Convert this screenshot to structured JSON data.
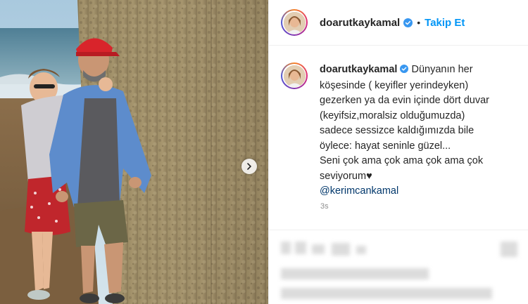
{
  "post": {
    "username": "doarutkaykamal",
    "follow_label": "Takip Et",
    "separator": "•",
    "caption_lines": [
      "Dünyanın her",
      "köşesinde ( keyifler yerindeyken)",
      "gezerken ya da evin içinde dört duvar",
      "(keyifsiz,moralsiz olduğumuzda)",
      "sadece sessizce kaldığımızda bile",
      "öylece: hayat seninle güzel...",
      "Seni çok ama çok ama çok ama çok",
      "seviyorum♥"
    ],
    "mention": "@kerimcankamal",
    "timestamp": "3s"
  },
  "colors": {
    "accent": "#0095f6",
    "verified": "#3897f0",
    "mention": "#00376b"
  },
  "icons": {
    "verified": "verified-badge-icon",
    "carousel": "carousel-next-icon"
  }
}
